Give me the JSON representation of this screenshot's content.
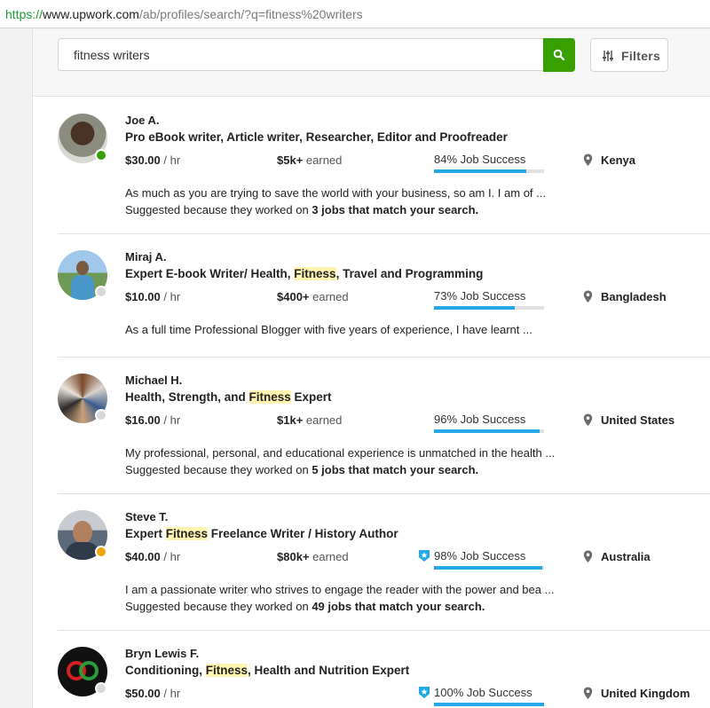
{
  "browser": {
    "url_scheme": "https://",
    "url_host": "www.upwork.com",
    "url_path": "/ab/profiles/search/?q=fitness%20writers"
  },
  "search": {
    "value": "fitness writers",
    "filters_label": "Filters",
    "search_icon": "search-icon",
    "dropdown_icon": "chevron-down-icon",
    "filters_icon": "sliders-icon"
  },
  "colors": {
    "accent_green": "#37a000",
    "online_green": "#37a000",
    "away_orange": "#f0a30a",
    "offline_gray": "#d8d8d8",
    "progress_blue": "#23a9e6",
    "highlight": "#fff4b0"
  },
  "freelancers": [
    {
      "name": "Joe A.",
      "title_pre": "Pro eBook writer, Article writer, Researcher, Editor and Proofreader",
      "title_hl": "",
      "title_post": "",
      "rate": "$30.00",
      "rate_unit": " / hr",
      "earned_value": "$5k+",
      "earned_label": " earned",
      "job_success": "84% Job Success",
      "job_success_pct": 84,
      "top_rated": false,
      "location": "Kenya",
      "status": "online",
      "description": "As much as you are trying to save the world with your business, so am I. I am of ...",
      "suggested_pre": "Suggested because they worked on ",
      "suggested_bold": "3 jobs that match your search."
    },
    {
      "name": "Miraj A.",
      "title_pre": "Expert E-book Writer/ Health, ",
      "title_hl": "Fitness",
      "title_post": ", Travel and Programming",
      "rate": "$10.00",
      "rate_unit": " / hr",
      "earned_value": "$400+",
      "earned_label": " earned",
      "job_success": "73% Job Success",
      "job_success_pct": 73,
      "top_rated": false,
      "location": "Bangladesh",
      "status": "offline",
      "description": "As a full time Professional Blogger with five years of experience, I have learnt ...",
      "suggested_pre": "",
      "suggested_bold": ""
    },
    {
      "name": "Michael H.",
      "title_pre": "Health, Strength, and ",
      "title_hl": "Fitness",
      "title_post": " Expert",
      "rate": "$16.00",
      "rate_unit": " / hr",
      "earned_value": "$1k+",
      "earned_label": " earned",
      "job_success": "96% Job Success",
      "job_success_pct": 96,
      "top_rated": false,
      "location": "United States",
      "status": "offline",
      "description": "My professional, personal, and educational experience is unmatched in the health ...",
      "suggested_pre": "Suggested because they worked on ",
      "suggested_bold": "5 jobs that match your search."
    },
    {
      "name": "Steve T.",
      "title_pre": "Expert ",
      "title_hl": "Fitness",
      "title_post": " Freelance Writer / History Author",
      "rate": "$40.00",
      "rate_unit": " / hr",
      "earned_value": "$80k+",
      "earned_label": " earned",
      "job_success": "98% Job Success",
      "job_success_pct": 98,
      "top_rated": true,
      "location": "Australia",
      "status": "away",
      "description": "I am a passionate writer who strives to engage the reader with the power and bea ...",
      "suggested_pre": "Suggested because they worked on ",
      "suggested_bold": "49 jobs that match your search."
    },
    {
      "name": "Bryn Lewis F.",
      "title_pre": "Conditioning, ",
      "title_hl": "Fitness",
      "title_post": ", Health and Nutrition Expert",
      "rate": "$50.00",
      "rate_unit": " / hr",
      "earned_value": "",
      "earned_label": "",
      "job_success": "100% Job Success",
      "job_success_pct": 100,
      "top_rated": true,
      "location": "United Kingdom",
      "status": "offline",
      "description": "",
      "suggested_pre": "",
      "suggested_bold": ""
    }
  ]
}
